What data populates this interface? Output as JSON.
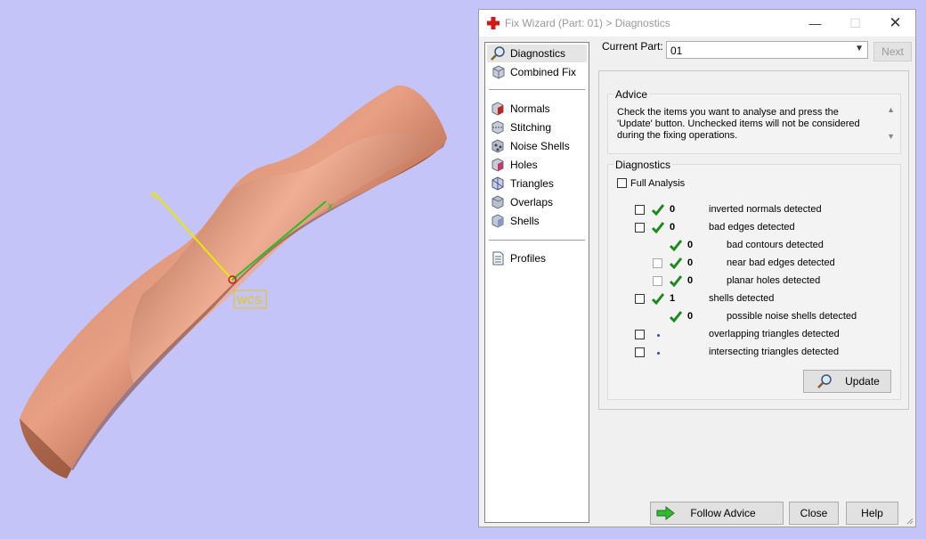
{
  "viewport": {
    "axis_x_label": "x",
    "wcs_label": "WCS"
  },
  "window": {
    "title": "Fix Wizard (Part: 01) > Diagnostics",
    "minimize": "—",
    "maximize": "☐",
    "close": "✕"
  },
  "nav": {
    "items": [
      {
        "label": "Diagnostics",
        "icon": "magnifier-icon"
      },
      {
        "label": "Combined Fix",
        "icon": "cube-icon"
      },
      {
        "label": "Normals",
        "icon": "normals-cube-icon"
      },
      {
        "label": "Stitching",
        "icon": "stitching-cube-icon"
      },
      {
        "label": "Noise Shells",
        "icon": "noise-shells-icon"
      },
      {
        "label": "Holes",
        "icon": "holes-cube-icon"
      },
      {
        "label": "Triangles",
        "icon": "triangles-icon"
      },
      {
        "label": "Overlaps",
        "icon": "overlaps-icon"
      },
      {
        "label": "Shells",
        "icon": "shells-icon"
      },
      {
        "label": "Profiles",
        "icon": "document-icon"
      }
    ]
  },
  "current_part": {
    "label": "Current Part:",
    "value": "01",
    "next_label": "Next"
  },
  "advice": {
    "heading": "Advice",
    "text": "Check the items you want to analyse and press the 'Update' button. Unchecked items will not be considered during the fixing operations."
  },
  "diagnostics": {
    "heading": "Diagnostics",
    "full_analysis_label": "Full Analysis",
    "rows": [
      {
        "count": "0",
        "label": "inverted normals detected"
      },
      {
        "count": "0",
        "label": "bad edges detected"
      },
      {
        "count": "0",
        "label": "bad contours detected"
      },
      {
        "count": "0",
        "label": "near bad edges detected"
      },
      {
        "count": "0",
        "label": "planar holes detected"
      },
      {
        "count": "1",
        "label": "shells detected"
      },
      {
        "count": "0",
        "label": "possible noise shells detected"
      },
      {
        "count": "",
        "label": "overlapping triangles detected"
      },
      {
        "count": "",
        "label": "intersecting triangles detected"
      }
    ],
    "update_label": "Update"
  },
  "footer": {
    "follow_advice_label": "Follow Advice",
    "close_label": "Close",
    "help_label": "Help"
  },
  "colors": {
    "background": "#c4c4f8",
    "model": "#b06448",
    "check_green": "#1e8a1e",
    "axis_yellow": "#e8e800",
    "axis_green": "#22c222"
  }
}
